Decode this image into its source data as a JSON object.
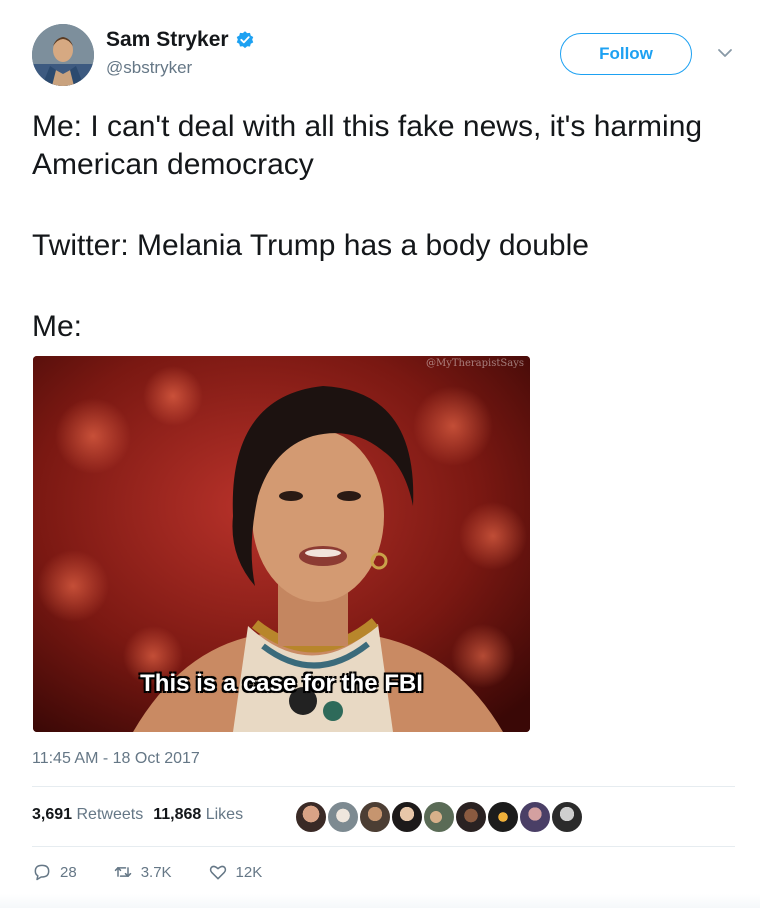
{
  "author": {
    "display_name": "Sam Stryker",
    "handle": "@sbstryker",
    "verified": true
  },
  "follow_label": "Follow",
  "tweet": {
    "line1": "Me: I can't deal with all this fake news, it's harming American democracy",
    "line2": "Twitter: Melania Trump has a body double",
    "line3": "Me:"
  },
  "media": {
    "caption": "This is a case for the FBI",
    "watermark": "@MyTherapistSays"
  },
  "timestamp": "11:45 AM - 18 Oct 2017",
  "stats": {
    "retweets_count": "3,691",
    "retweets_label": "Retweets",
    "likes_count": "11,868",
    "likes_label": "Likes"
  },
  "actions": {
    "reply_count": "28",
    "retweet_count": "3.7K",
    "like_count": "12K"
  },
  "colors": {
    "accent": "#1da1f2",
    "muted": "#657786",
    "text": "#14171a"
  }
}
